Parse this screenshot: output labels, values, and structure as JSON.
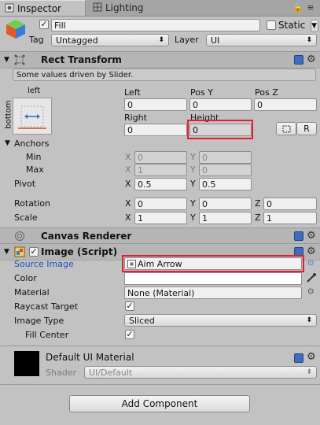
{
  "tabs": [
    {
      "label": "Inspector",
      "icon": "inspector-icon"
    },
    {
      "label": "Lighting",
      "icon": "lighting-icon"
    }
  ],
  "object": {
    "name": "Fill",
    "static_label": "Static",
    "tag_label": "Tag",
    "tag_value": "Untagged",
    "layer_label": "Layer",
    "layer_value": "UI"
  },
  "rect_transform": {
    "title": "Rect Transform",
    "info": "Some values driven by Slider.",
    "anchor_preset_top": "left",
    "anchor_preset_side": "bottom",
    "labels": {
      "left": "Left",
      "pos_y": "Pos Y",
      "pos_z": "Pos Z",
      "right": "Right",
      "height": "Height"
    },
    "values": {
      "left": "0",
      "pos_y": "0",
      "pos_z": "0",
      "right": "0",
      "height": "0"
    },
    "raw_btn": "R",
    "anchors_label": "Anchors",
    "min_label": "Min",
    "max_label": "Max",
    "min_x": "0",
    "min_y": "0",
    "max_x": "1",
    "max_y": "0",
    "pivot_label": "Pivot",
    "pivot_x": "0.5",
    "pivot_y": "0.5",
    "rotation_label": "Rotation",
    "rotation": {
      "x": "0",
      "y": "0",
      "z": "0"
    },
    "scale_label": "Scale",
    "scale": {
      "x": "1",
      "y": "1",
      "z": "1"
    },
    "axis": {
      "x": "X",
      "y": "Y",
      "z": "Z"
    }
  },
  "canvas_renderer": {
    "title": "Canvas Renderer"
  },
  "image": {
    "title": "Image (Script)",
    "source_label": "Source Image",
    "source_value": "Aim Arrow",
    "color_label": "Color",
    "material_label": "Material",
    "material_value": "None (Material)",
    "raycast_label": "Raycast Target",
    "image_type_label": "Image Type",
    "image_type_value": "Sliced",
    "fill_center_label": "Fill Center",
    "check": "✓"
  },
  "material": {
    "title": "Default UI Material",
    "shader_label": "Shader",
    "shader_value": "UI/Default"
  },
  "add_component": "Add Component",
  "colors": {
    "accent": "#1f4fc0",
    "highlight": "#e02030"
  }
}
